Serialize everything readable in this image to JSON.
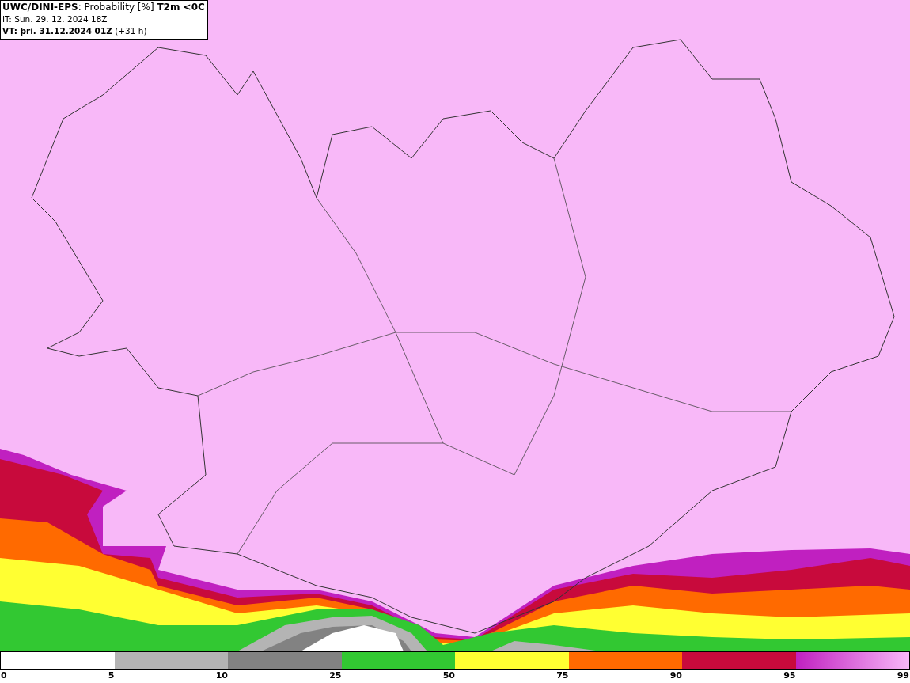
{
  "header": {
    "title": "**UWC/DINI-EPS**: Probability [%] **T2m <0C**",
    "init_time": "IT: Sun. 29. 12. 2024 18Z",
    "valid_time": "**VT: þri. 31.12.2024 01Z** (+31 h)"
  },
  "legend": {
    "segments": [
      {
        "color": "#ffffff"
      },
      {
        "color": "#b4b4b4"
      },
      {
        "color": "#828282"
      },
      {
        "color": "#32c832"
      },
      {
        "color": "#ffff32"
      },
      {
        "color": "#ff6a00"
      },
      {
        "color": "#c80a3c"
      },
      {
        "kind": "gradient"
      }
    ],
    "labels": [
      "0",
      "5",
      "10",
      "25",
      "50",
      "75",
      "90",
      "95",
      "99"
    ]
  }
}
